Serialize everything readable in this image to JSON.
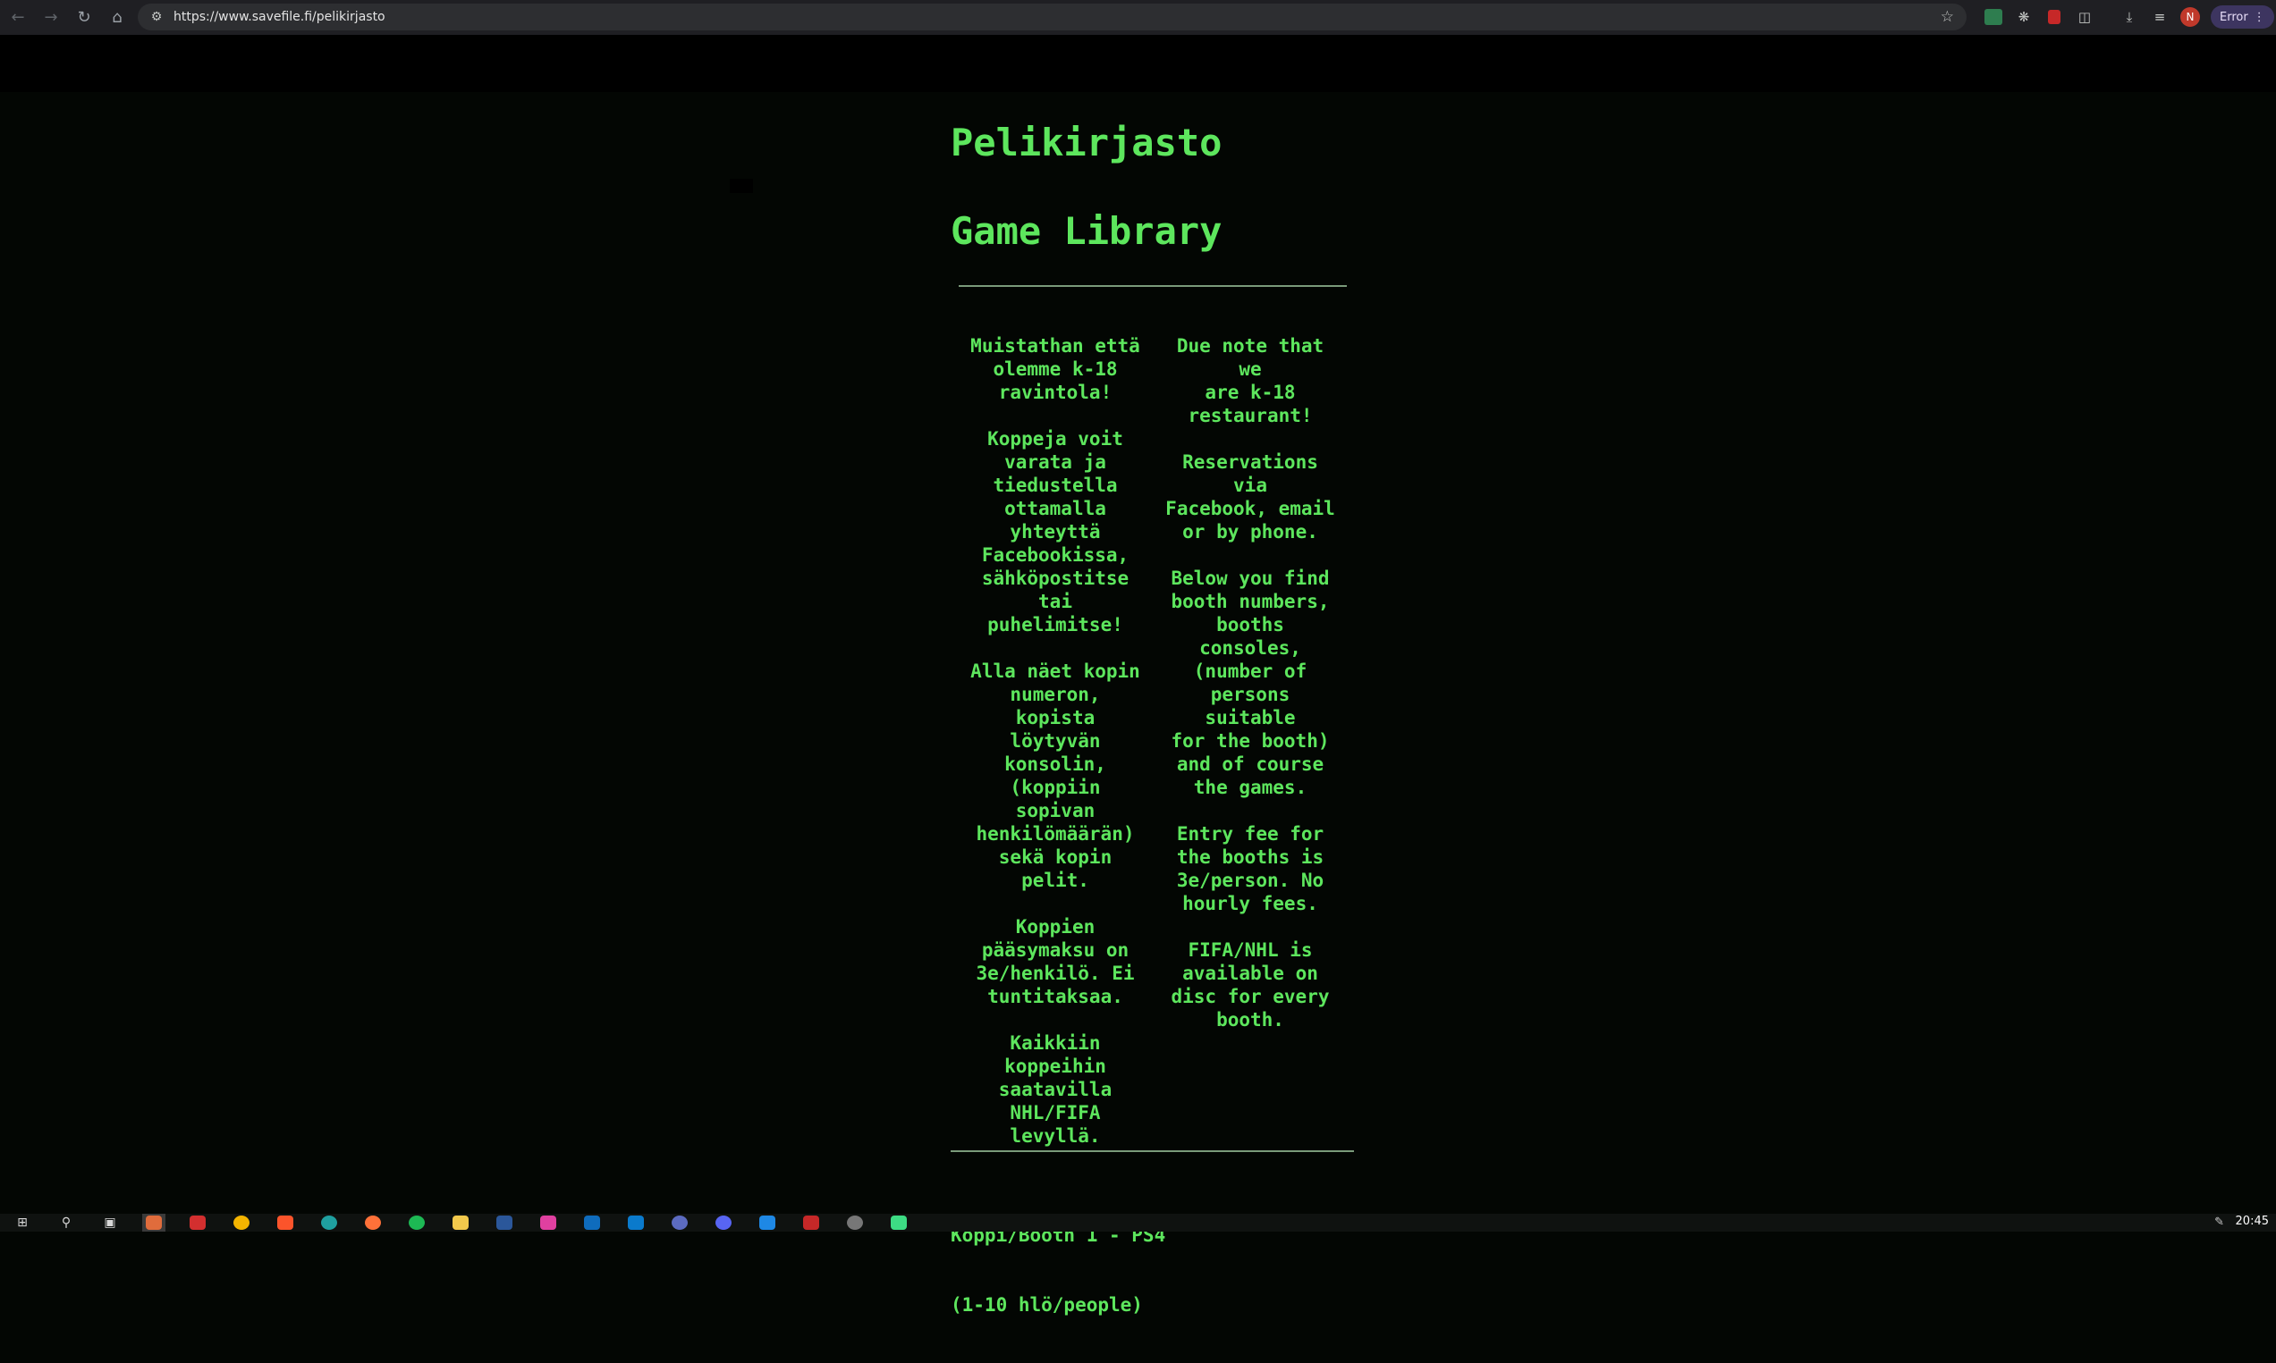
{
  "browser": {
    "url": "https://www.savefile.fi/pelikirjasto",
    "error_chip": "Error",
    "profile_initial": "N",
    "extensions": [
      "new-extension-icon",
      "gear-icon",
      "pdf-icon",
      "puzzle-icon",
      "download-icon",
      "tab-search-icon"
    ]
  },
  "page": {
    "title_fi": "Pelikirjasto",
    "title_en": "Game Library",
    "col_fi": "Muistathan että\nolemme k-18\nravintola!\n\nKoppeja voit\nvarata ja\ntiedustella\nottamalla\nyhteyttä\nFacebookissa,\nsähköpostitse\ntai puhelimitse!\n\nAlla näet kopin\nnumeron, kopista\nlöytyvän\nkonsolin,\n(koppiin sopivan\nhenkilömäärän)\nsekä kopin\npelit.\n\nKoppien\npääsymaksu on\n3e/henkilö. Ei\ntuntitaksaa.\n\nKaikkiin\nkoppeihin\nsaatavilla\nNHL/FIFA\nlevyllä.",
    "col_en": "Due note that we\nare k-18\nrestaurant!\n\nReservations via\nFacebook, email\nor by phone.\n\nBelow you find\nbooth numbers,\nbooths consoles,\n(number of\npersons suitable\nfor the booth)\nand of course\nthe games.\n\nEntry fee for\nthe booths is\n3e/person. No\nhourly fees.\n\nFIFA/NHL is\navailable on\ndisc for every\nbooth.",
    "booth_heading": "Koppi/Booth 1 - PS4",
    "booth_sub": "(1-10 hlö/people)"
  },
  "taskbar": {
    "clock": "20:45"
  }
}
